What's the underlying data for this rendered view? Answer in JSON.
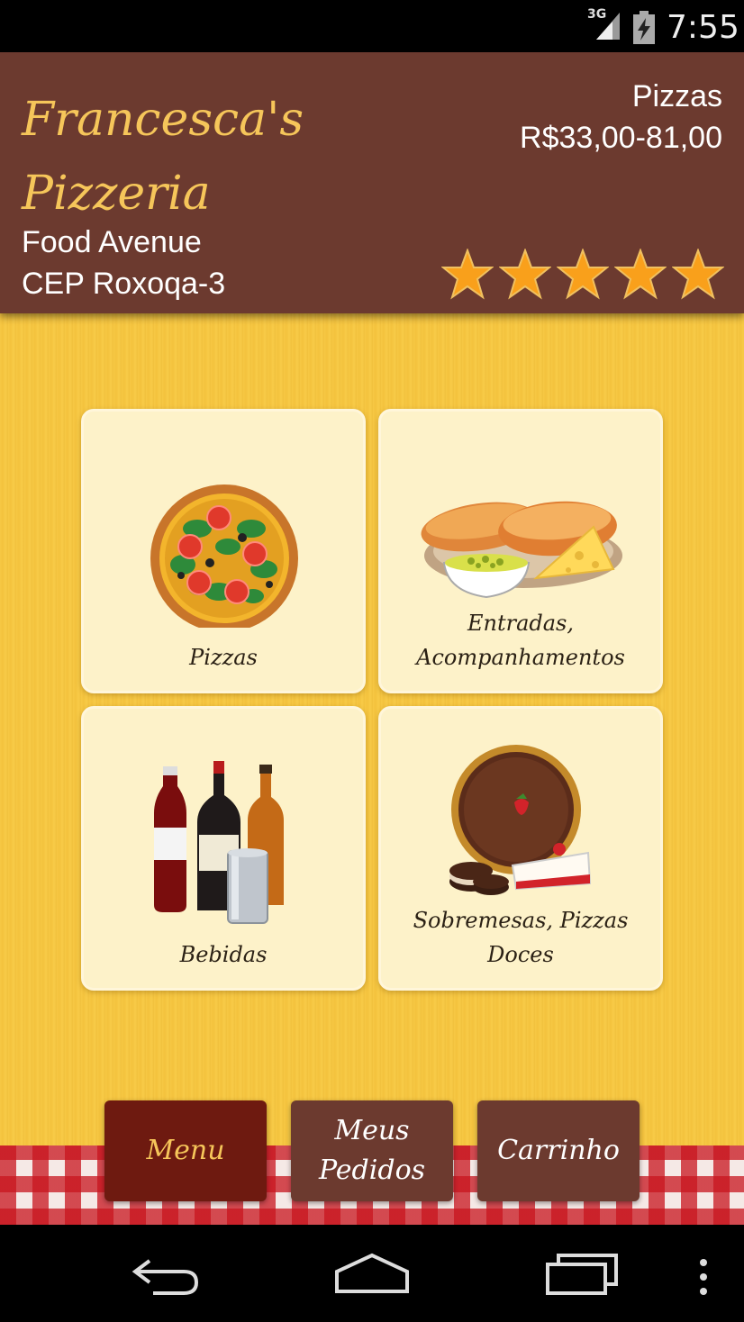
{
  "status_bar": {
    "network": "3G",
    "time": "7:55"
  },
  "restaurant": {
    "name": "Francesca's Pizzeria",
    "address_line1": "Food Avenue",
    "address_line2": "CEP Roxoqa-3",
    "category": "Pizzas",
    "price_range": "R$33,00-81,00",
    "rating": 5,
    "rating_max": 5
  },
  "menu": {
    "categories": [
      {
        "label": "Pizzas",
        "icon": "pizza-icon"
      },
      {
        "label": "Entradas, Acompanhamentos",
        "icon": "bread-cheese-icon"
      },
      {
        "label": "Bebidas",
        "icon": "drinks-icon"
      },
      {
        "label": "Sobremesas, Pizzas Doces",
        "icon": "dessert-icon"
      }
    ]
  },
  "tabs": [
    {
      "label": "Menu",
      "active": true
    },
    {
      "label": "Meus Pedidos",
      "active": false
    },
    {
      "label": "Carrinho",
      "active": false
    }
  ],
  "colors": {
    "header_bg": "#6c3a2f",
    "title_accent": "#f6c65a",
    "main_bg": "#f6c843",
    "tile_bg": "#fdf2c9",
    "active_tab": "#6e1a10"
  },
  "navbar": {
    "icons": [
      "back-icon",
      "home-icon",
      "recent-apps-icon",
      "overflow-menu-icon"
    ]
  }
}
